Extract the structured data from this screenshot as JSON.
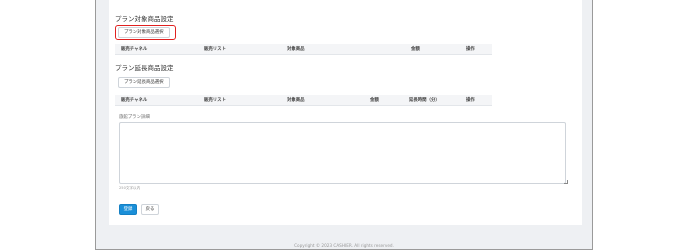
{
  "plan_target": {
    "title": "プラン対象商品設定",
    "select_button": "プラン対象商品選択",
    "columns": [
      "販売チャネル",
      "販売リスト",
      "対象商品",
      "金額",
      "操作"
    ]
  },
  "plan_extension": {
    "title": "プラン延長商品設定",
    "select_button": "プラン延長商品選択",
    "columns": [
      "販売チャネル",
      "販売リスト",
      "対象商品",
      "金額",
      "延長時間（分）",
      "操作"
    ]
  },
  "detail": {
    "label": "旅館プラン詳細",
    "value": "",
    "char_limit": "250文字以内"
  },
  "actions": {
    "register": "登録",
    "back": "戻る"
  },
  "footer": {
    "copyright": "Copyright © 2023 CASHIER. All rights reserved."
  },
  "colors": {
    "highlight": "#e0201f",
    "primary": "#1a8fd8"
  }
}
